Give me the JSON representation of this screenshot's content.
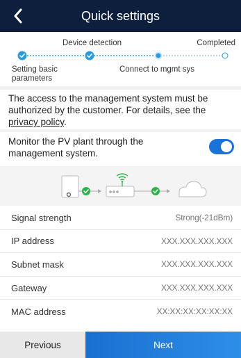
{
  "header": {
    "title": "Quick settings",
    "back_icon": "chevron-left-icon"
  },
  "steps": [
    {
      "label": "Setting basic parameters",
      "status": "completed"
    },
    {
      "label": "Device detection",
      "status": "completed"
    },
    {
      "label": "Connect to mgmt sys",
      "status": "current"
    },
    {
      "label": "Completed",
      "status": "pending"
    }
  ],
  "notice": {
    "text": "The access to the management system must be authorized by the customer. For details, see the ",
    "link": "privacy policy",
    "suffix": "."
  },
  "monitor": {
    "label": "Monitor the PV plant through the management system.",
    "enabled": true
  },
  "diagram": {
    "icons": [
      "inverter-icon",
      "check-icon",
      "router-wifi-icon",
      "check-icon",
      "cloud-icon"
    ]
  },
  "info": [
    {
      "label": "Signal strength",
      "value": "Strong(-21dBm)"
    },
    {
      "label": "IP address",
      "value": "XXX.XXX.XXX.XXX"
    },
    {
      "label": "Subnet mask",
      "value": "XXX.XXX.XXX.XXX"
    },
    {
      "label": "Gateway",
      "value": "XXX.XXX.XXX.XXX"
    },
    {
      "label": "MAC address",
      "value": "XX:XX:XX:XX:XX:XX"
    }
  ],
  "footer": {
    "previous_label": "Previous",
    "next_label": "Next"
  },
  "colors": {
    "header_bg": "#0d1f3c",
    "accent": "#1a73d8",
    "step_done": "#2a9be0",
    "check_green": "#2bb34a"
  }
}
